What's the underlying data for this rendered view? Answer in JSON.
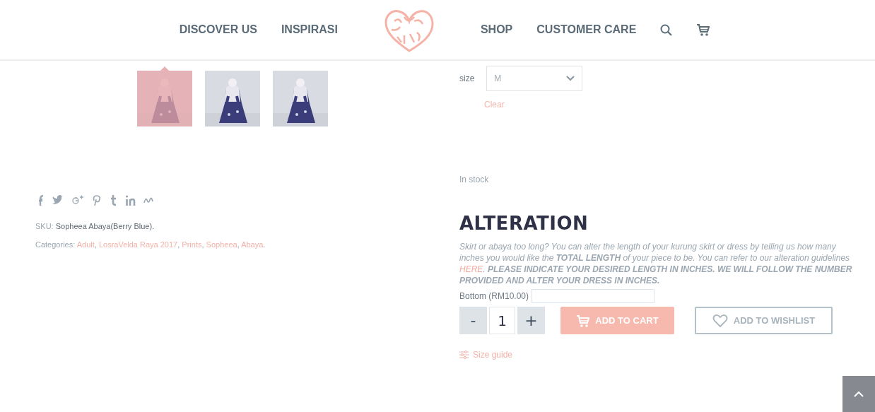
{
  "header": {
    "nav_left": [
      "DISCOVER US",
      "INSPIRASI"
    ],
    "nav_right": [
      "SHOP",
      "CUSTOMER CARE"
    ]
  },
  "thumbnails": [
    {
      "kind": "picture",
      "selected": true
    },
    {
      "kind": "picture",
      "selected": false
    },
    {
      "kind": "picture",
      "selected": false
    }
  ],
  "sku": {
    "label": "SKU:",
    "value": "Sopheea Abaya(Berry Blue)."
  },
  "categories": {
    "label": "Categories:",
    "items": [
      "Adult",
      "LosraVelda Raya 2017",
      "Prints",
      "Sopheea",
      "Abaya"
    ],
    "separator": ",",
    "end": "."
  },
  "variation": {
    "label": "size",
    "value": "M",
    "clear": "Clear"
  },
  "stock": "In stock",
  "alteration": {
    "title": "ALTERATION",
    "text_before": "Skirt or abaya too long? You can alter the length of your kurung skirt or dress by telling us how many inches you would like the **TOTAL LENGTH** of your piece to be. You can refer to our alteration guidelines",
    "link": "HERE",
    "text_after": ". **PLEASE INDICATE YOUR DESIRED LENGTH IN INCHES. WE WILL FOLLOW THE NUMBER PROVIDED AND ALTER YOUR DRESS IN INCHES.**",
    "field_label": "Bottom (RM10.00)"
  },
  "quantity": {
    "minus": "-",
    "value": "1",
    "plus": "+"
  },
  "add_to_cart": "ADD TO CART",
  "add_to_wishlist": "ADD TO WISHLIST",
  "size_guide": "Size guide"
}
